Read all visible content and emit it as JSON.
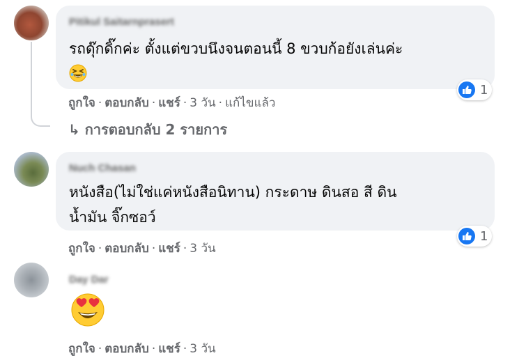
{
  "comments": [
    {
      "author": "Pitikul Saitarnprasert",
      "text_line1": "รถดุ๊กดิ๊กค่ะ ตั้งแต่ขวบนึงจนตอนนี้ 8 ขวบก้อยังเล่นค่ะ",
      "emoji": "grinning-squinting-face",
      "reaction_count": "1",
      "actions": {
        "like": "ถูกใจ",
        "reply": "ตอบกลับ",
        "share": "แชร์",
        "time": "3 วัน",
        "edited": "แก้ไขแล้ว"
      },
      "replies_label": "การตอบกลับ 2 รายการ"
    },
    {
      "author": "Nuch Chasan",
      "text_line1": "หนังสือ(ไม่ใช่แค่หนังสือนิทาน) กระดาษ ดินสอ สี ดิน",
      "text_line2": "น้ำมัน จิ๊กซอว์",
      "reaction_count": "1",
      "actions": {
        "like": "ถูกใจ",
        "reply": "ตอบกลับ",
        "share": "แชร์",
        "time": "3 วัน"
      }
    },
    {
      "author": "Day Dar",
      "emoji": "heart-eyes-face",
      "actions": {
        "like": "ถูกใจ",
        "reply": "ตอบกลับ",
        "share": "แชร์",
        "time": "3 วัน"
      }
    }
  ],
  "colors": {
    "bubble": "#f0f2f5",
    "meta": "#65676b",
    "like_blue": "#1877f2"
  },
  "separator": "·",
  "reply_arrow": "↳"
}
